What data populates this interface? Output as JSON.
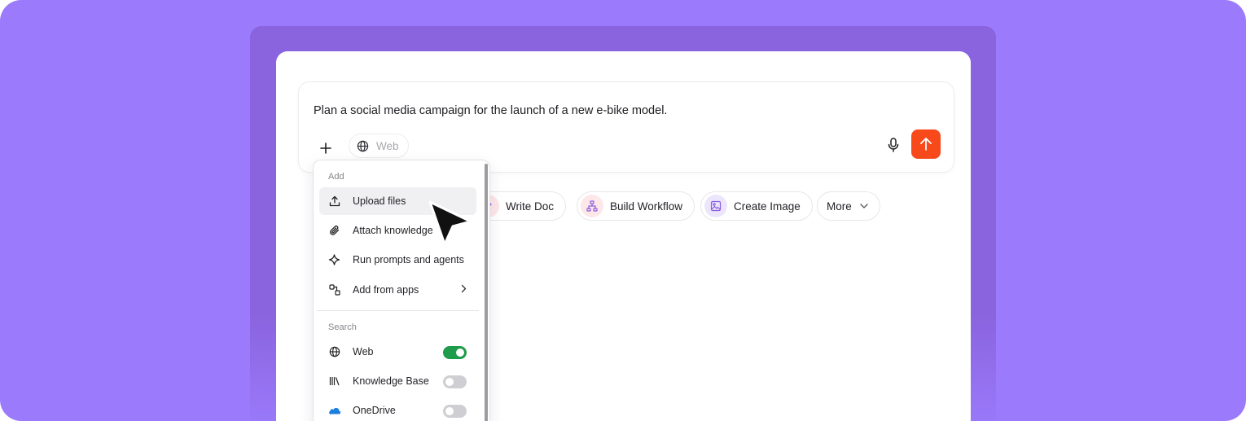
{
  "composer": {
    "prompt": "Plan a social media campaign for the launch of a new e-bike model.",
    "web_chip_label": "Web"
  },
  "colors": {
    "background": "#9b7bfc",
    "send_button": "#f8491a",
    "toggle_on": "#1f9b4c"
  },
  "quick_actions": [
    {
      "label": "Write Doc",
      "icon": "pencil-icon"
    },
    {
      "label": "Build Workflow",
      "icon": "workflow-icon"
    },
    {
      "label": "Create Image",
      "icon": "image-icon"
    },
    {
      "label": "More",
      "icon": "chevron-down-icon"
    }
  ],
  "menu": {
    "add_section": "Add",
    "add_items": [
      {
        "label": "Upload files",
        "icon": "upload-icon"
      },
      {
        "label": "Attach knowledge",
        "icon": "paperclip-icon"
      },
      {
        "label": "Run prompts and agents",
        "icon": "sparkle-icon"
      },
      {
        "label": "Add from apps",
        "icon": "apps-icon"
      }
    ],
    "search_section": "Search",
    "search_items": [
      {
        "label": "Web",
        "icon": "globe-icon",
        "enabled": true
      },
      {
        "label": "Knowledge Base",
        "icon": "library-icon",
        "enabled": false
      },
      {
        "label": "OneDrive",
        "icon": "onedrive-icon",
        "enabled": false
      }
    ]
  }
}
